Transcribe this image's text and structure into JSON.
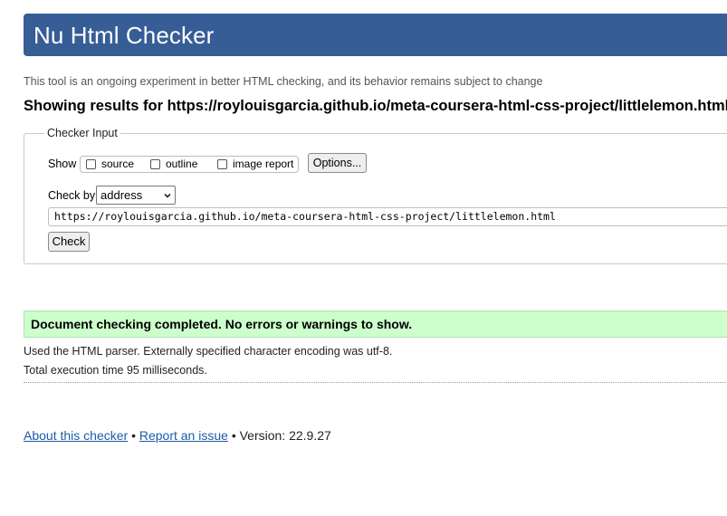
{
  "header": {
    "title": "Nu Html Checker"
  },
  "intro": "This tool is an ongoing experiment in better HTML checking, and its behavior remains subject to change",
  "showing": "Showing results for https://roylouisgarcia.github.io/meta-coursera-html-css-project/littlelemon.html",
  "checker_input": {
    "legend": "Checker Input",
    "show_label": "Show",
    "options": {
      "source": "source",
      "outline": "outline",
      "image_report": "image report"
    },
    "options_button": "Options...",
    "check_by_label": "Check by",
    "check_by_value": "address",
    "url_value": "https://roylouisgarcia.github.io/meta-coursera-html-css-project/littlelemon.html",
    "check_button": "Check"
  },
  "result": {
    "message": "Document checking completed. No errors or warnings to show.",
    "parser_info": "Used the HTML parser. Externally specified character encoding was utf-8.",
    "execution_time": "Total execution time 95 milliseconds."
  },
  "footer": {
    "about_link": "About this checker",
    "separator": "•",
    "report_link": "Report an issue",
    "version": "Version: 22.9.27"
  },
  "colors": {
    "header_bg": "#365d95",
    "success_bg": "#ccffcc",
    "link": "#1e5aa8"
  }
}
